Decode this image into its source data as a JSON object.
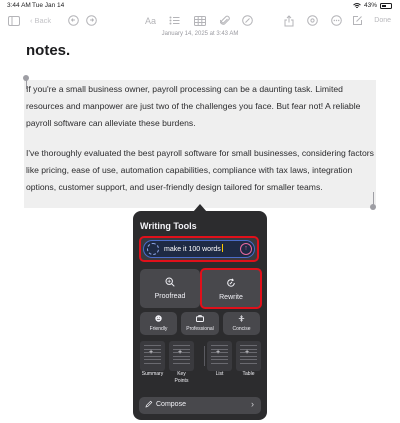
{
  "status_bar": {
    "time": "3:44 AM",
    "date": "Tue Jan 14",
    "battery": "43%"
  },
  "toolbar": {
    "back_label": "Back",
    "done_label": "Done",
    "aa_label": "Aa"
  },
  "note": {
    "date_line": "January 14, 2025 at 3:43 AM",
    "title": "notes.",
    "paragraphs": [
      "If you're a small business owner, payroll processing can be a daunting task. Limited resources and manpower are just two of the challenges you face. But fear not! A reliable payroll software can alleviate these burdens.",
      "I've thoroughly evaluated the best payroll software for small businesses, considering factors like pricing, ease of use, automation capabilities, compliance with tax laws, integration options, customer support, and user-friendly design tailored for smaller teams."
    ]
  },
  "writing_tools": {
    "title": "Writing Tools",
    "input_value": "make it 100 words",
    "proofread_label": "Proofread",
    "rewrite_label": "Rewrite",
    "tone_buttons": [
      "Friendly",
      "Professional",
      "Concise"
    ],
    "format_buttons": [
      "Summary",
      "Key Points",
      "List",
      "Table"
    ],
    "compose_label": "Compose"
  },
  "colors": {
    "highlight_red": "#e0101a",
    "panel": "#2c2c2e",
    "button": "#48484c"
  },
  "icons": [
    "sidebar-icon",
    "back-chevron-icon",
    "undo-icon",
    "redo-icon",
    "checklist-icon",
    "table-icon",
    "attachment-icon",
    "markup-icon",
    "share-icon",
    "at-icon",
    "more-icon",
    "compose-note-icon",
    "search-sparkle-icon",
    "rewrite-icon",
    "smile-icon",
    "briefcase-icon",
    "concise-icon",
    "pencil-icon",
    "chevron-right-icon",
    "send-icon"
  ]
}
